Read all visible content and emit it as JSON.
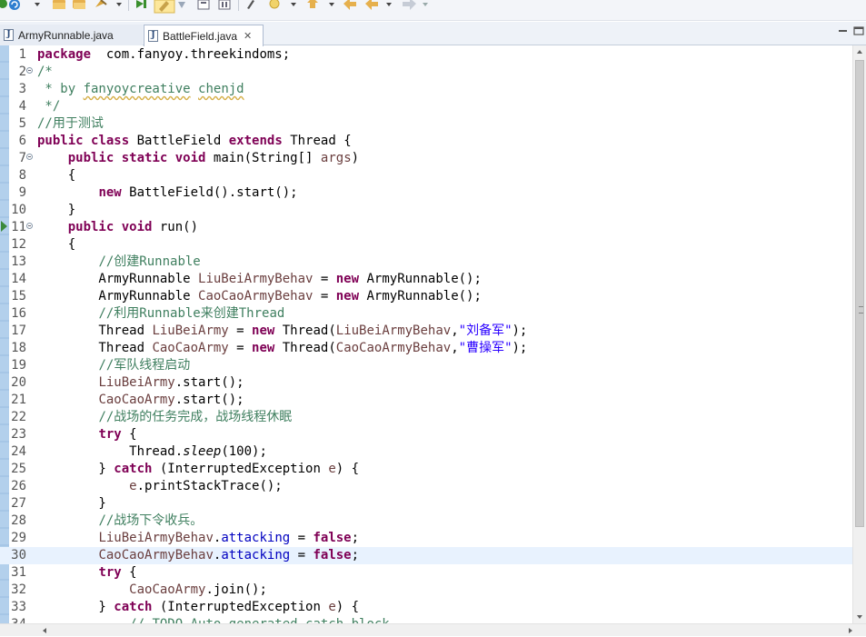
{
  "toolbar": {
    "icons": [
      "run-icon",
      "new-icon",
      "open-folder-icon",
      "open-type-icon",
      "refactor-icon",
      "debug-icon",
      "highlight-icon",
      "toggle-icon",
      "pin-icon",
      "gear-icon",
      "bookmark-icon",
      "annotation-icon",
      "back-icon",
      "forward-icon"
    ]
  },
  "tabs": [
    {
      "label": "ArmyRunnable.java",
      "active": false
    },
    {
      "label": "BattleField.java",
      "active": true,
      "close": "✕"
    }
  ],
  "editor": {
    "current_line": 30,
    "lines": [
      {
        "n": "1",
        "t": [
          [
            "kw",
            "package"
          ],
          [
            "",
            "  com.fanyoy.threekindoms;"
          ]
        ]
      },
      {
        "n": "2",
        "fold": true,
        "t": [
          [
            "cm",
            "/*"
          ]
        ]
      },
      {
        "n": "3",
        "t": [
          [
            "cm",
            " * by "
          ],
          [
            "cm squig",
            "fanyoycreative"
          ],
          [
            "cm",
            " "
          ],
          [
            "cm squig",
            "chenjd"
          ]
        ]
      },
      {
        "n": "4",
        "t": [
          [
            "cm",
            " */"
          ]
        ]
      },
      {
        "n": "5",
        "t": [
          [
            "cm",
            "//用于测试"
          ]
        ]
      },
      {
        "n": "6",
        "t": [
          [
            "kw",
            "public"
          ],
          [
            "",
            " "
          ],
          [
            "kw",
            "class"
          ],
          [
            "",
            " BattleField "
          ],
          [
            "kw",
            "extends"
          ],
          [
            "",
            " Thread {"
          ]
        ]
      },
      {
        "n": "7",
        "fold": true,
        "t": [
          [
            "",
            "    "
          ],
          [
            "kw",
            "public"
          ],
          [
            "",
            " "
          ],
          [
            "kw",
            "static"
          ],
          [
            "",
            " "
          ],
          [
            "kw",
            "void"
          ],
          [
            "",
            " main(String[] "
          ],
          [
            "var",
            "args"
          ],
          [
            "",
            ")"
          ]
        ]
      },
      {
        "n": "8",
        "t": [
          [
            "",
            "    {"
          ]
        ]
      },
      {
        "n": "9",
        "t": [
          [
            "",
            "        "
          ],
          [
            "kw",
            "new"
          ],
          [
            "",
            " BattleField().start();"
          ]
        ]
      },
      {
        "n": "10",
        "t": [
          [
            "",
            "    }"
          ]
        ]
      },
      {
        "n": "11",
        "fold": true,
        "marker": true,
        "t": [
          [
            "",
            "    "
          ],
          [
            "kw",
            "public"
          ],
          [
            "",
            " "
          ],
          [
            "kw",
            "void"
          ],
          [
            "",
            " run()"
          ]
        ]
      },
      {
        "n": "12",
        "t": [
          [
            "",
            "    {"
          ]
        ]
      },
      {
        "n": "13",
        "t": [
          [
            "",
            "        "
          ],
          [
            "cm",
            "//创建Runnable"
          ]
        ]
      },
      {
        "n": "14",
        "t": [
          [
            "",
            "        ArmyRunnable "
          ],
          [
            "var",
            "LiuBeiArmyBehav"
          ],
          [
            "",
            " = "
          ],
          [
            "kw",
            "new"
          ],
          [
            "",
            " ArmyRunnable();"
          ]
        ]
      },
      {
        "n": "15",
        "t": [
          [
            "",
            "        ArmyRunnable "
          ],
          [
            "var",
            "CaoCaoArmyBehav"
          ],
          [
            "",
            " = "
          ],
          [
            "kw",
            "new"
          ],
          [
            "",
            " ArmyRunnable();"
          ]
        ]
      },
      {
        "n": "16",
        "t": [
          [
            "",
            "        "
          ],
          [
            "cm",
            "//利用Runnable来创建Thread"
          ]
        ]
      },
      {
        "n": "17",
        "t": [
          [
            "",
            "        Thread "
          ],
          [
            "var",
            "LiuBeiArmy"
          ],
          [
            "",
            " = "
          ],
          [
            "kw",
            "new"
          ],
          [
            "",
            " Thread("
          ],
          [
            "var",
            "LiuBeiArmyBehav"
          ],
          [
            "",
            ","
          ],
          [
            "str",
            "\"刘备军\""
          ],
          [
            "",
            ");"
          ]
        ]
      },
      {
        "n": "18",
        "t": [
          [
            "",
            "        Thread "
          ],
          [
            "var",
            "CaoCaoArmy"
          ],
          [
            "",
            " = "
          ],
          [
            "kw",
            "new"
          ],
          [
            "",
            " Thread("
          ],
          [
            "var",
            "CaoCaoArmyBehav"
          ],
          [
            "",
            ","
          ],
          [
            "str",
            "\"曹操军\""
          ],
          [
            "",
            ");"
          ]
        ]
      },
      {
        "n": "19",
        "t": [
          [
            "",
            "        "
          ],
          [
            "cm",
            "//军队线程启动"
          ]
        ]
      },
      {
        "n": "20",
        "t": [
          [
            "",
            "        "
          ],
          [
            "var",
            "LiuBeiArmy"
          ],
          [
            "",
            ".start();"
          ]
        ]
      },
      {
        "n": "21",
        "t": [
          [
            "",
            "        "
          ],
          [
            "var",
            "CaoCaoArmy"
          ],
          [
            "",
            ".start();"
          ]
        ]
      },
      {
        "n": "22",
        "t": [
          [
            "",
            "        "
          ],
          [
            "cm",
            "//战场的任务完成，战场线程休眠"
          ]
        ]
      },
      {
        "n": "23",
        "t": [
          [
            "",
            "        "
          ],
          [
            "kw",
            "try"
          ],
          [
            "",
            " {"
          ]
        ]
      },
      {
        "n": "24",
        "t": [
          [
            "",
            "            Thread."
          ],
          [
            "ital",
            "sleep"
          ],
          [
            "",
            "(100);"
          ]
        ]
      },
      {
        "n": "25",
        "t": [
          [
            "",
            "        } "
          ],
          [
            "kw",
            "catch"
          ],
          [
            "",
            " (InterruptedException "
          ],
          [
            "var",
            "e"
          ],
          [
            "",
            ") {"
          ]
        ]
      },
      {
        "n": "26",
        "t": [
          [
            "",
            "            "
          ],
          [
            "var",
            "e"
          ],
          [
            "",
            ".printStackTrace();"
          ]
        ]
      },
      {
        "n": "27",
        "t": [
          [
            "",
            "        }"
          ]
        ]
      },
      {
        "n": "28",
        "t": [
          [
            "",
            "        "
          ],
          [
            "cm",
            "//战场下令收兵。"
          ]
        ]
      },
      {
        "n": "29",
        "t": [
          [
            "",
            "        "
          ],
          [
            "var",
            "LiuBeiArmyBehav"
          ],
          [
            "",
            "."
          ],
          [
            "fld",
            "attacking"
          ],
          [
            "",
            " = "
          ],
          [
            "kw",
            "false"
          ],
          [
            "",
            ";"
          ]
        ]
      },
      {
        "n": "30",
        "t": [
          [
            "",
            "        "
          ],
          [
            "var",
            "CaoCaoArmyBehav"
          ],
          [
            "",
            "."
          ],
          [
            "fld",
            "attacking"
          ],
          [
            "",
            " = "
          ],
          [
            "kw",
            "false"
          ],
          [
            "",
            ";"
          ]
        ]
      },
      {
        "n": "31",
        "t": [
          [
            "",
            "        "
          ],
          [
            "kw",
            "try"
          ],
          [
            "",
            " {"
          ]
        ]
      },
      {
        "n": "32",
        "t": [
          [
            "",
            "            "
          ],
          [
            "var",
            "CaoCaoArmy"
          ],
          [
            "",
            ".join();"
          ]
        ]
      },
      {
        "n": "33",
        "t": [
          [
            "",
            "        } "
          ],
          [
            "kw",
            "catch"
          ],
          [
            "",
            " (InterruptedException "
          ],
          [
            "var",
            "e"
          ],
          [
            "",
            ") {"
          ]
        ]
      },
      {
        "n": "34",
        "t": [
          [
            "",
            "            "
          ],
          [
            "cm",
            "// TODO Auto-generated catch block"
          ]
        ]
      }
    ]
  }
}
